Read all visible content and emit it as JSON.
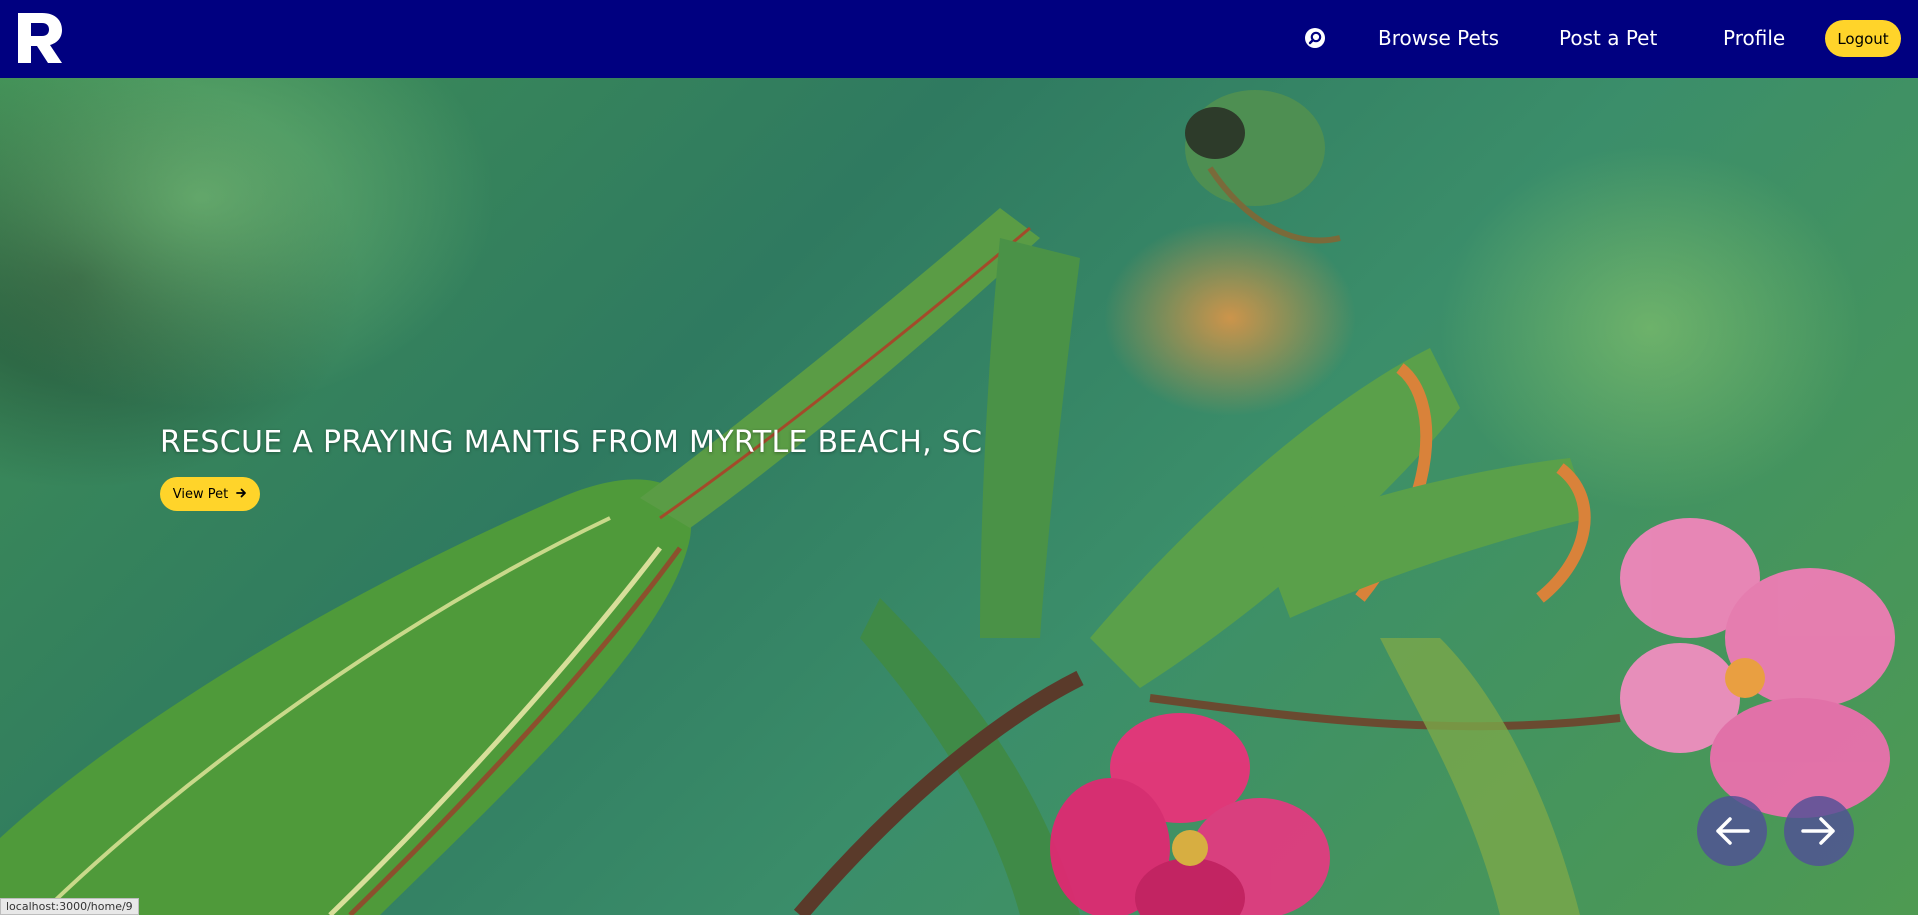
{
  "nav": {
    "logo_letter": "R",
    "links": {
      "browse": "Browse Pets",
      "post": "Post a Pet",
      "profile": "Profile"
    },
    "logout_label": "Logout",
    "search_icon": "search-icon"
  },
  "hero": {
    "caption": "RESCUE A PRAYING MANTIS FROM MYRTLE BEACH, SC",
    "view_label": "View Pet",
    "view_icon": "arrow-right-icon",
    "carousel": {
      "prev_icon": "arrow-left-icon",
      "next_icon": "arrow-right-icon"
    }
  },
  "status_bar": {
    "url": "localhost:3000/home/9"
  },
  "colors": {
    "navbar": "#000080",
    "accent": "#ffd42a",
    "carousel_button": "#505096"
  }
}
